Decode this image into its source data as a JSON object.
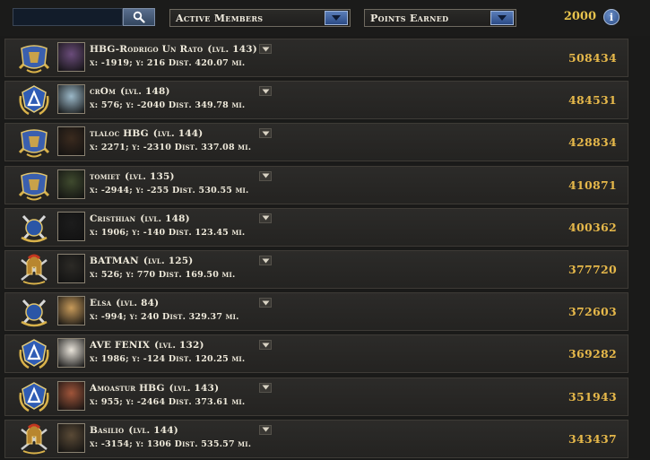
{
  "search": {
    "placeholder": ""
  },
  "filters": {
    "members_select": "Active Members",
    "sort_select": "Points Earned"
  },
  "total_points": "2000",
  "info_label": "i",
  "members": [
    {
      "name": "HBG-Rodrigo Un Rato",
      "level": "(lvl. 143)",
      "coords": "x: -1919; y: 216",
      "dist": "Dist. 420.07 mi.",
      "points": "508434",
      "emblem": "blue-shield-emblem",
      "avatar": "warrior-avatar",
      "avatar_color": "#6a4c7a"
    },
    {
      "name": "crOm",
      "level": "(lvl. 148)",
      "coords": "x: 576; y: -2040",
      "dist": "Dist. 349.78 mi.",
      "points": "484531",
      "emblem": "blue-crest-emblem",
      "avatar": "white-creature-avatar",
      "avatar_color": "#9bb8c8"
    },
    {
      "name": "tlaloc HBG",
      "level": "(lvl. 144)",
      "coords": "x: 2271; y: -2310",
      "dist": "Dist. 337.08 mi.",
      "points": "428834",
      "emblem": "blue-shield-emblem",
      "avatar": "dark-figure-avatar",
      "avatar_color": "#3a2a1e"
    },
    {
      "name": "tomiet",
      "level": "(lvl. 135)",
      "coords": "x: -2944; y: -255",
      "dist": "Dist. 530.55 mi.",
      "points": "410871",
      "emblem": "blue-shield-emblem",
      "avatar": "hooded-figure-avatar",
      "avatar_color": "#3f4a2e"
    },
    {
      "name": "Cristhian",
      "level": "(lvl. 148)",
      "coords": "x: 1906; y: -140",
      "dist": "Dist. 123.45 mi.",
      "points": "400362",
      "emblem": "crossed-swords-emblem",
      "avatar": "knot-symbol-avatar",
      "avatar_color": "#1c1c1c"
    },
    {
      "name": "BATMAN",
      "level": "(lvl. 125)",
      "coords": "x: 526; y: 770",
      "dist": "Dist. 169.50 mi.",
      "points": "377720",
      "emblem": "spartan-helmet-emblem",
      "avatar": "masked-hero-avatar",
      "avatar_color": "#2c2a26"
    },
    {
      "name": "Elsa",
      "level": "(lvl. 84)",
      "coords": "x: -994; y: 240",
      "dist": "Dist. 329.37 mi.",
      "points": "372603",
      "emblem": "crossed-swords-emblem",
      "avatar": "woman-avatar",
      "avatar_color": "#c79a5a"
    },
    {
      "name": "AVE FENIX",
      "level": "(lvl. 132)",
      "coords": "x: 1986; y: -124",
      "dist": "Dist. 120.25 mi.",
      "points": "369282",
      "emblem": "blue-crest-emblem",
      "avatar": "cartoon-bird-avatar",
      "avatar_color": "#e9e4da"
    },
    {
      "name": "Amoastur HBG",
      "level": "(lvl. 143)",
      "coords": "x: 955; y: -2464",
      "dist": "Dist. 373.61 mi.",
      "points": "351943",
      "emblem": "blue-crest-emblem",
      "avatar": "painting-avatar",
      "avatar_color": "#a0553a"
    },
    {
      "name": "Basilio",
      "level": "(lvl. 144)",
      "coords": "x: -3154; y: 1306",
      "dist": "Dist. 535.57 mi.",
      "points": "343437",
      "emblem": "spartan-helmet-emblem",
      "avatar": "knight-avatar",
      "avatar_color": "#5a4a36"
    }
  ]
}
